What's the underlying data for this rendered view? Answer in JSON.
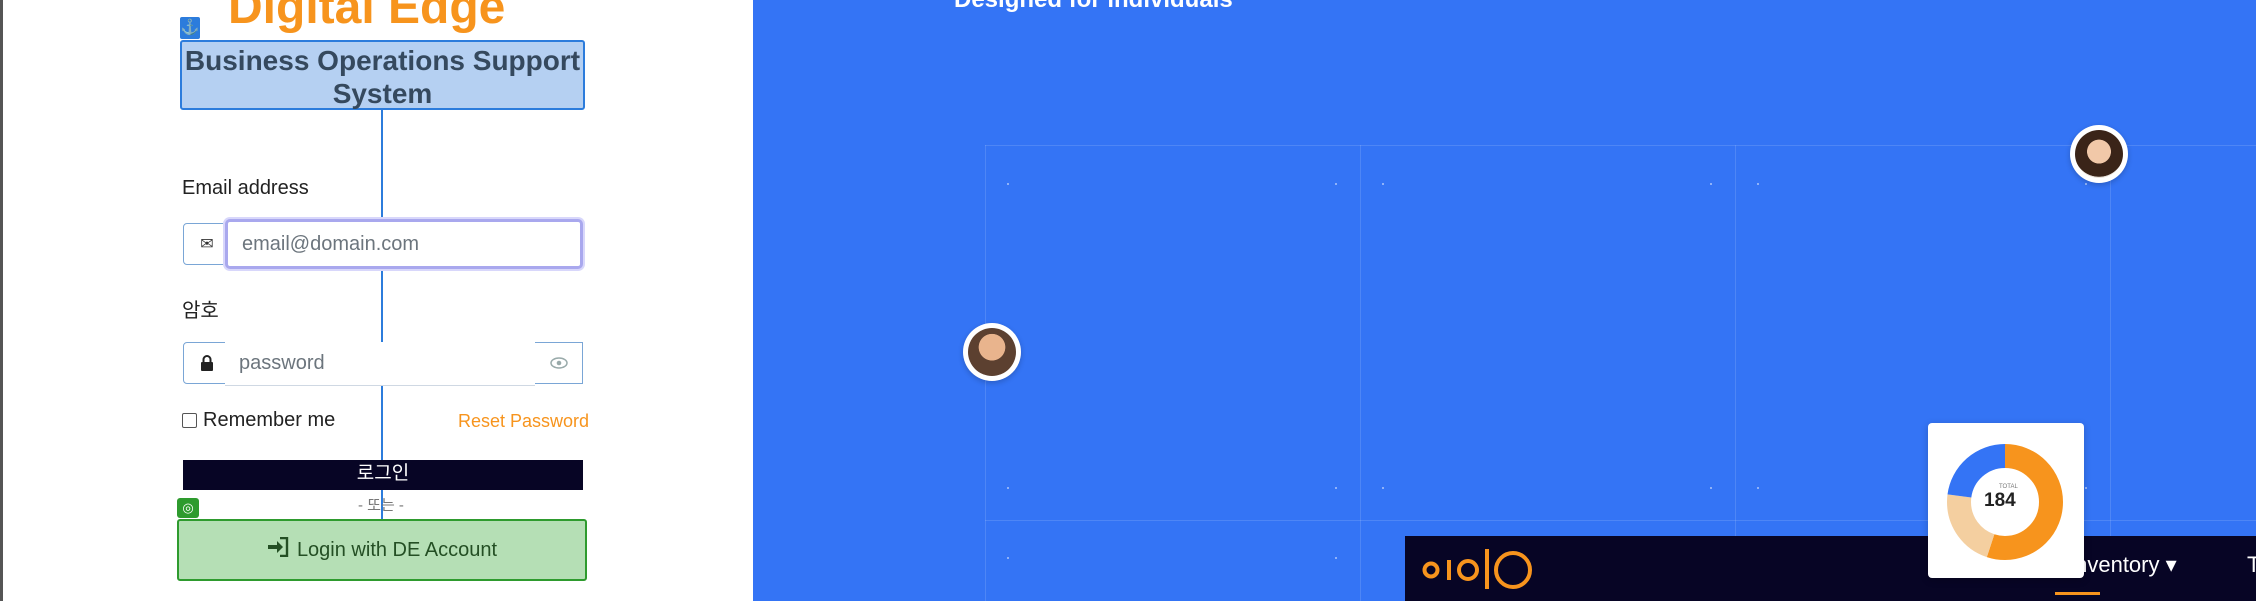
{
  "login": {
    "brand_title": "Digital Edge",
    "subtitle": "Business Operations Support System",
    "email_label": "Email address",
    "email_placeholder": "email@domain.com",
    "password_label": "암호",
    "password_placeholder": "password",
    "remember_label": "Remember me",
    "reset_label": "Reset Password",
    "login_button": "로그인",
    "or_text": "- 또는 -",
    "de_button": "Login with DE Account"
  },
  "hero": {
    "tagline": "Designed for individuals"
  },
  "nav": {
    "items": [
      "Inventory ▾",
      "Ticket"
    ]
  },
  "donut": {
    "total_label": "TOTAL",
    "total_value": "184",
    "segments": [
      {
        "fraction": 0.55,
        "color": "#f7941d"
      },
      {
        "fraction": 0.22,
        "color": "#f4cfa0"
      },
      {
        "fraction": 0.23,
        "color": "#3474f5"
      }
    ]
  },
  "colors": {
    "accent": "#f7941d",
    "hero_background": "#3474f5",
    "navy": "#070525",
    "highlight_blue": "#2c7cdc",
    "highlight_green": "#2e9b2e"
  },
  "icons": [
    "anchor-icon",
    "envelope-icon",
    "lock-icon",
    "eye-icon",
    "target-icon",
    "sign-in-icon"
  ]
}
